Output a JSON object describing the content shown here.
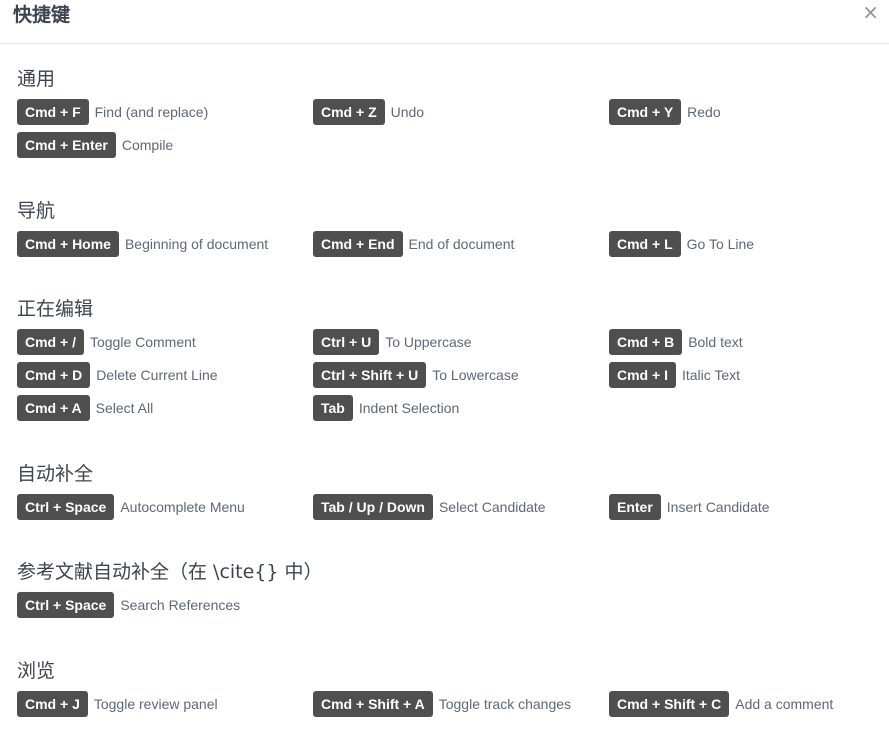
{
  "dialog": {
    "title": "快捷键",
    "close_label": "×"
  },
  "sections": [
    {
      "title": "通用",
      "rows": [
        [
          {
            "key": "Cmd + F",
            "desc": "Find (and replace)"
          },
          {
            "key": "Cmd + Z",
            "desc": "Undo"
          },
          {
            "key": "Cmd + Y",
            "desc": "Redo"
          }
        ],
        [
          {
            "key": "Cmd + Enter",
            "desc": "Compile"
          }
        ]
      ]
    },
    {
      "title": "导航",
      "rows": [
        [
          {
            "key": "Cmd + Home",
            "desc": "Beginning of document"
          },
          {
            "key": "Cmd + End",
            "desc": "End of document"
          },
          {
            "key": "Cmd + L",
            "desc": "Go To Line"
          }
        ]
      ]
    },
    {
      "title": "正在编辑",
      "rows": [
        [
          {
            "key": "Cmd + /",
            "desc": "Toggle Comment"
          },
          {
            "key": "Ctrl + U",
            "desc": "To Uppercase"
          },
          {
            "key": "Cmd + B",
            "desc": "Bold text"
          }
        ],
        [
          {
            "key": "Cmd + D",
            "desc": "Delete Current Line"
          },
          {
            "key": "Ctrl + Shift + U",
            "desc": "To Lowercase"
          },
          {
            "key": "Cmd + I",
            "desc": "Italic Text"
          }
        ],
        [
          {
            "key": "Cmd + A",
            "desc": "Select All"
          },
          {
            "key": "Tab",
            "desc": "Indent Selection"
          }
        ]
      ]
    },
    {
      "title": "自动补全",
      "rows": [
        [
          {
            "key": "Ctrl + Space",
            "desc": "Autocomplete Menu"
          },
          {
            "key": "Tab / Up / Down",
            "desc": "Select Candidate"
          },
          {
            "key": "Enter",
            "desc": "Insert Candidate"
          }
        ]
      ]
    },
    {
      "title": "参考文献自动补全（在 \\cite{} 中）",
      "rows": [
        [
          {
            "key": "Ctrl + Space",
            "desc": "Search References"
          }
        ]
      ]
    },
    {
      "title": "浏览",
      "rows": [
        [
          {
            "key": "Cmd + J",
            "desc": "Toggle review panel"
          },
          {
            "key": "Cmd + Shift + A",
            "desc": "Toggle track changes"
          },
          {
            "key": "Cmd + Shift + C",
            "desc": "Add a comment"
          }
        ]
      ]
    }
  ],
  "colors": {
    "key_background": "#4f4f4f",
    "key_text": "#ffffff",
    "description_text": "#5d6879",
    "heading_text": "#3d4450"
  }
}
